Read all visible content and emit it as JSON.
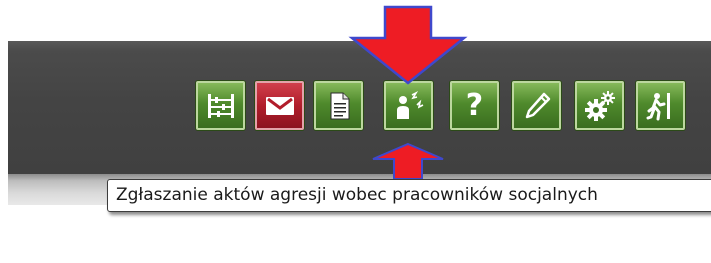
{
  "toolbar": {
    "buttons": [
      {
        "icon": "calculator-icon"
      },
      {
        "icon": "mail-icon"
      },
      {
        "icon": "document-icon"
      },
      {
        "icon": "aggression-report-icon"
      },
      {
        "icon": "help-icon",
        "label": "?"
      },
      {
        "icon": "pencil-icon"
      },
      {
        "icon": "gears-icon"
      },
      {
        "icon": "exit-icon"
      }
    ]
  },
  "tooltip": {
    "text": "Zgłaszanie aktów agresji wobec pracowników socjalnych"
  },
  "colors": {
    "button_green": "#4f8a2c",
    "mail_red": "#b11d2b",
    "arrow_red": "#ee1c24",
    "arrow_outline": "#3f48cc",
    "toolbar_dark": "#444444"
  }
}
